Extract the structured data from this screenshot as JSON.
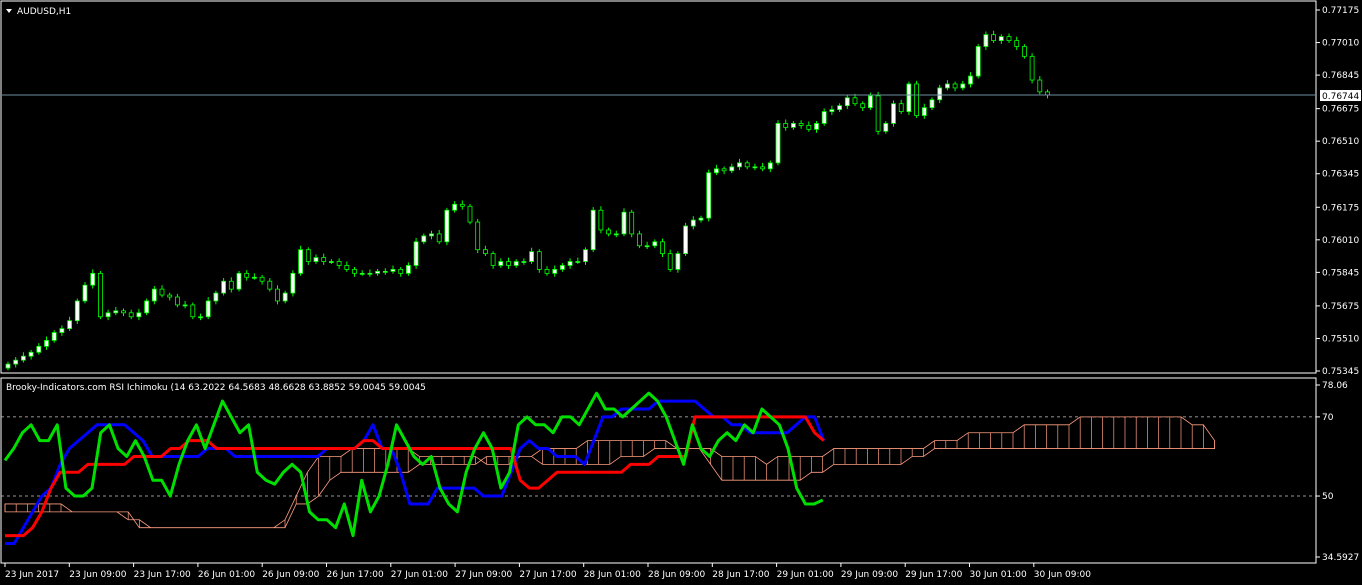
{
  "colors": {
    "background": "#000000",
    "frame": "#ffffff",
    "bull_candle": "#ffffff",
    "bear_candle": "#000000",
    "wick": "#00ff00",
    "price_line": "#6e8fa0",
    "rsi": "#00e000",
    "tenkan": "#ff0000",
    "kijun": "#0000ff",
    "kumo": "#ff9e80",
    "level_line": "#c8c8c8"
  },
  "main_panel": {
    "title": "AUDUSD,H1",
    "menu_icon": "triangle-down-icon",
    "current_price_label": "0.76744"
  },
  "indicator_panel": {
    "title": "Brooky-Indicators.com RSI Ichimoku (14 63.2022 64.5683 48.6628 63.8852 59.0045 59.0045"
  },
  "chart_data": [
    {
      "type": "candlestick",
      "title": "AUDUSD,H1",
      "xlabel": "",
      "ylabel": "",
      "ylim": [
        0.75345,
        0.77175
      ],
      "yticks": [
        "0.77175",
        "0.77010",
        "0.76845",
        "0.76675",
        "0.76510",
        "0.76345",
        "0.76175",
        "0.76010",
        "0.75845",
        "0.75675",
        "0.75510",
        "0.75345"
      ],
      "last_price": 0.76744,
      "x_tick_labels": [
        "23 Jun 2017",
        "23 Jun 09:00",
        "23 Jun 17:00",
        "26 Jun 01:00",
        "26 Jun 09:00",
        "26 Jun 17:00",
        "27 Jun 01:00",
        "27 Jun 09:00",
        "27 Jun 17:00",
        "28 Jun 01:00",
        "28 Jun 09:00",
        "28 Jun 17:00",
        "29 Jun 01:00",
        "29 Jun 09:00",
        "29 Jun 17:00",
        "30 Jun 01:00",
        "30 Jun 09:00"
      ],
      "close": [
        0.7538,
        0.754,
        0.7542,
        0.7544,
        0.7547,
        0.755,
        0.7554,
        0.7556,
        0.756,
        0.757,
        0.7578,
        0.7584,
        0.7562,
        0.7564,
        0.7565,
        0.7564,
        0.7562,
        0.7564,
        0.757,
        0.7576,
        0.7573,
        0.7572,
        0.7568,
        0.7568,
        0.7562,
        0.7562,
        0.757,
        0.7574,
        0.758,
        0.7576,
        0.7584,
        0.7582,
        0.7582,
        0.758,
        0.7576,
        0.757,
        0.7574,
        0.7584,
        0.7596,
        0.759,
        0.7592,
        0.759,
        0.759,
        0.7588,
        0.7586,
        0.7584,
        0.7584,
        0.7584,
        0.7585,
        0.7585,
        0.7586,
        0.7584,
        0.7588,
        0.76,
        0.7603,
        0.7604,
        0.76,
        0.7616,
        0.7619,
        0.7618,
        0.761,
        0.7596,
        0.7594,
        0.7588,
        0.759,
        0.7588,
        0.759,
        0.759,
        0.7595,
        0.7586,
        0.7584,
        0.7586,
        0.7588,
        0.759,
        0.759,
        0.7596,
        0.7616,
        0.7606,
        0.7604,
        0.7604,
        0.7615,
        0.7604,
        0.7598,
        0.7598,
        0.76,
        0.7594,
        0.7586,
        0.7594,
        0.7608,
        0.7611,
        0.7612,
        0.7635,
        0.7637,
        0.7636,
        0.7638,
        0.764,
        0.7638,
        0.7638,
        0.7637,
        0.764,
        0.766,
        0.7658,
        0.766,
        0.7659,
        0.7657,
        0.766,
        0.7666,
        0.7667,
        0.7669,
        0.7673,
        0.767,
        0.7668,
        0.7674,
        0.7656,
        0.766,
        0.767,
        0.7666,
        0.768,
        0.7664,
        0.7668,
        0.7672,
        0.7678,
        0.768,
        0.7678,
        0.768,
        0.7684,
        0.7699,
        0.7705,
        0.7702,
        0.7704,
        0.7702,
        0.7699,
        0.7694,
        0.7682,
        0.7676,
        0.76744
      ]
    },
    {
      "type": "line",
      "title": "Brooky-Indicators.com RSI Ichimoku (14 63.2022 64.5683 48.6628 63.8852 59.0045 59.0045",
      "xlabel": "",
      "ylabel": "",
      "ylim": [
        34.5927,
        78.06
      ],
      "yticks": [
        "78.06",
        "70",
        "50",
        "34.5927"
      ],
      "levels": [
        70,
        50
      ],
      "series": [
        {
          "role": "rsi",
          "color": "#00e000",
          "values": [
            59,
            62,
            66,
            68,
            64,
            64,
            68,
            52,
            50,
            50,
            52,
            66,
            68,
            62,
            60,
            64,
            60,
            54,
            54,
            50,
            58,
            64,
            68,
            62,
            68,
            74,
            70,
            66,
            68,
            56,
            54,
            53,
            56,
            58,
            56,
            46,
            44,
            44,
            42,
            48,
            40,
            54,
            46,
            50,
            58,
            68,
            64,
            60,
            58,
            60,
            52,
            48,
            46,
            56,
            62,
            66,
            62,
            52,
            56,
            68,
            70,
            68,
            68,
            66,
            70,
            70,
            68,
            72,
            76,
            72,
            72,
            70,
            72,
            74,
            76,
            74,
            70,
            64,
            58,
            68,
            62,
            60,
            64,
            66,
            64,
            68,
            66,
            72,
            70,
            68,
            62,
            52,
            48,
            48,
            49
          ]
        },
        {
          "role": "tenkan",
          "color": "#ff0000",
          "values": [
            40,
            40,
            40,
            42,
            46,
            52,
            56,
            56,
            56,
            58,
            58,
            58,
            58,
            58,
            60,
            60,
            60,
            60,
            62,
            62,
            64,
            64,
            64,
            62,
            62,
            62,
            62,
            62,
            62,
            62,
            62,
            62,
            62,
            62,
            62,
            62,
            62,
            62,
            62,
            64,
            64,
            62,
            62,
            62,
            62,
            62,
            62,
            62,
            62,
            62,
            62,
            62,
            62,
            62,
            62,
            62,
            54,
            52,
            52,
            54,
            56,
            56,
            56,
            56,
            56,
            56,
            56,
            56,
            58,
            58,
            58,
            60,
            60,
            60,
            60,
            70,
            70,
            70,
            70,
            70,
            70,
            70,
            70,
            70,
            70,
            70,
            70,
            70,
            66,
            64
          ]
        },
        {
          "role": "kijun",
          "color": "#0000ff",
          "values": [
            38,
            38,
            42,
            46,
            50,
            52,
            58,
            62,
            64,
            66,
            68,
            68,
            68,
            68,
            66,
            64,
            60,
            60,
            60,
            60,
            60,
            60,
            62,
            62,
            62,
            60,
            60,
            60,
            60,
            60,
            60,
            60,
            60,
            60,
            60,
            62,
            62,
            62,
            62,
            64,
            68,
            62,
            62,
            56,
            48,
            48,
            48,
            52,
            52,
            52,
            52,
            52,
            50,
            50,
            50,
            56,
            62,
            64,
            62,
            62,
            60,
            60,
            60,
            58,
            64,
            70,
            70,
            72,
            72,
            72,
            72,
            74,
            74,
            74,
            74,
            74,
            72,
            70,
            70,
            68,
            68,
            66,
            66,
            66,
            66,
            66,
            68,
            70,
            70,
            64
          ]
        },
        {
          "role": "kumo_top",
          "color": "#ff9e80",
          "values": [
            46,
            46,
            46,
            46,
            46,
            46,
            46,
            46,
            46,
            46,
            46,
            44,
            44,
            42,
            42,
            42,
            42,
            42,
            42,
            42,
            42,
            42,
            42,
            42,
            42,
            44,
            50,
            56,
            60,
            60,
            60,
            62,
            62,
            62,
            62,
            62,
            62,
            60,
            60,
            60,
            60,
            60,
            60,
            58,
            58,
            58,
            60,
            60,
            62,
            62,
            62,
            62,
            64,
            64,
            64,
            64,
            64,
            64,
            64,
            64,
            62,
            62,
            62,
            62,
            60,
            60,
            60,
            60,
            58,
            60,
            60,
            60,
            60,
            60,
            62,
            62,
            62,
            62,
            62,
            62,
            62,
            62,
            62,
            64,
            64,
            64,
            66,
            66,
            66,
            66,
            66,
            68,
            68,
            68,
            68,
            68,
            70,
            70,
            70,
            70,
            70,
            70,
            70,
            70,
            70,
            70,
            68,
            68,
            64
          ]
        },
        {
          "role": "kumo_bottom",
          "color": "#ff9e80",
          "values": [
            48,
            48,
            48,
            48,
            48,
            48,
            46,
            46,
            46,
            46,
            46,
            46,
            42,
            42,
            42,
            42,
            42,
            42,
            42,
            42,
            42,
            42,
            42,
            42,
            42,
            42,
            48,
            48,
            50,
            54,
            56,
            56,
            56,
            56,
            56,
            56,
            56,
            58,
            58,
            58,
            58,
            58,
            58,
            60,
            60,
            60,
            60,
            60,
            58,
            58,
            58,
            58,
            58,
            58,
            58,
            60,
            60,
            60,
            62,
            62,
            62,
            62,
            62,
            58,
            54,
            54,
            54,
            54,
            54,
            54,
            54,
            54,
            56,
            56,
            58,
            58,
            58,
            58,
            58,
            58,
            58,
            60,
            60,
            62,
            62,
            62,
            62,
            62,
            62,
            62,
            62,
            62,
            62,
            62,
            62,
            62,
            62,
            62,
            62,
            62,
            62,
            62,
            62,
            62,
            62,
            62,
            62,
            62,
            62
          ]
        }
      ]
    }
  ]
}
